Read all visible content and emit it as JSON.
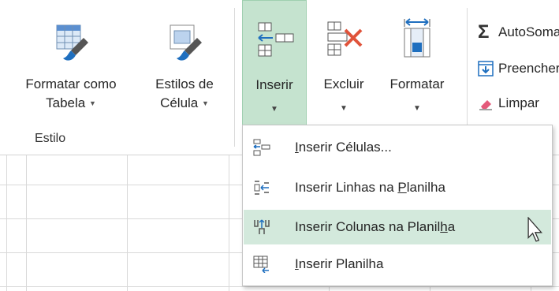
{
  "ribbon": {
    "buttons": [
      {
        "line1": "Formatar como",
        "line2": "Tabela"
      },
      {
        "line1": "Estilos de",
        "line2": "Célula"
      },
      {
        "line1": "Inserir",
        "line2": ""
      },
      {
        "line1": "Excluir",
        "line2": ""
      },
      {
        "line1": "Formatar",
        "line2": ""
      }
    ],
    "group_label": "Estilo",
    "editing": [
      {
        "label": "AutoSoma",
        "icon": "sigma-icon"
      },
      {
        "label": "Preencher",
        "icon": "fill-down-icon"
      },
      {
        "label": "Limpar",
        "icon": "eraser-icon"
      }
    ]
  },
  "menu": {
    "items": [
      {
        "pre": "",
        "key": "I",
        "post": "nserir Células...",
        "icon": "insert-cells-icon"
      },
      {
        "pre": "Inserir Linhas na ",
        "key": "P",
        "post": "lanilha",
        "icon": "insert-rows-icon"
      },
      {
        "pre": "Inserir Colunas na Planil",
        "key": "h",
        "post": "a",
        "icon": "insert-columns-icon",
        "highlighted": true
      },
      {
        "pre": "",
        "key": "I",
        "post": "nserir Planilha",
        "icon": "insert-sheet-icon"
      }
    ]
  },
  "colors": {
    "accent_selected": "#c5e3cf",
    "menu_highlight": "#d3e9dc",
    "delete_red": "#e0533a",
    "brush_blue": "#1f6fbf"
  }
}
